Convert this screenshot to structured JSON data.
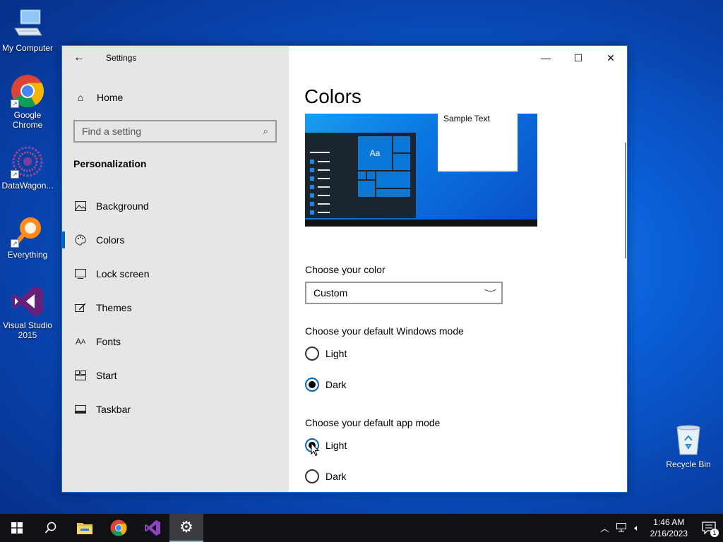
{
  "desktop": {
    "icons": [
      {
        "label": "My Computer"
      },
      {
        "label": "Google Chrome"
      },
      {
        "label": "DataWagon..."
      },
      {
        "label": "Everything"
      },
      {
        "label": "Visual Studio 2015"
      },
      {
        "label": "Recycle Bin"
      }
    ]
  },
  "window": {
    "title": "Settings",
    "home_label": "Home",
    "search_placeholder": "Find a setting",
    "section": "Personalization",
    "nav": [
      {
        "label": "Background",
        "icon": "picture-icon"
      },
      {
        "label": "Colors",
        "icon": "palette-icon",
        "active": true
      },
      {
        "label": "Lock screen",
        "icon": "lock-screen-icon"
      },
      {
        "label": "Themes",
        "icon": "themes-icon"
      },
      {
        "label": "Fonts",
        "icon": "fonts-icon"
      },
      {
        "label": "Start",
        "icon": "start-icon"
      },
      {
        "label": "Taskbar",
        "icon": "taskbar-icon"
      }
    ]
  },
  "colors_page": {
    "title": "Colors",
    "preview_sample_text": "Sample Text",
    "preview_tile_text": "Aa",
    "choose_color_label": "Choose your color",
    "choose_color_value": "Custom",
    "windows_mode_label": "Choose your default Windows mode",
    "windows_mode_options": [
      {
        "label": "Light",
        "selected": false
      },
      {
        "label": "Dark",
        "selected": true
      }
    ],
    "app_mode_label": "Choose your default app mode",
    "app_mode_options": [
      {
        "label": "Light",
        "selected": true
      },
      {
        "label": "Dark",
        "selected": false
      }
    ]
  },
  "taskbar": {
    "time": "1:46 AM",
    "date": "2/16/2023",
    "notification_count": "1"
  },
  "colors": {
    "accent": "#0067c0",
    "sidebar_bg": "#e6e6e6",
    "taskbar_bg": "#0f1115"
  }
}
